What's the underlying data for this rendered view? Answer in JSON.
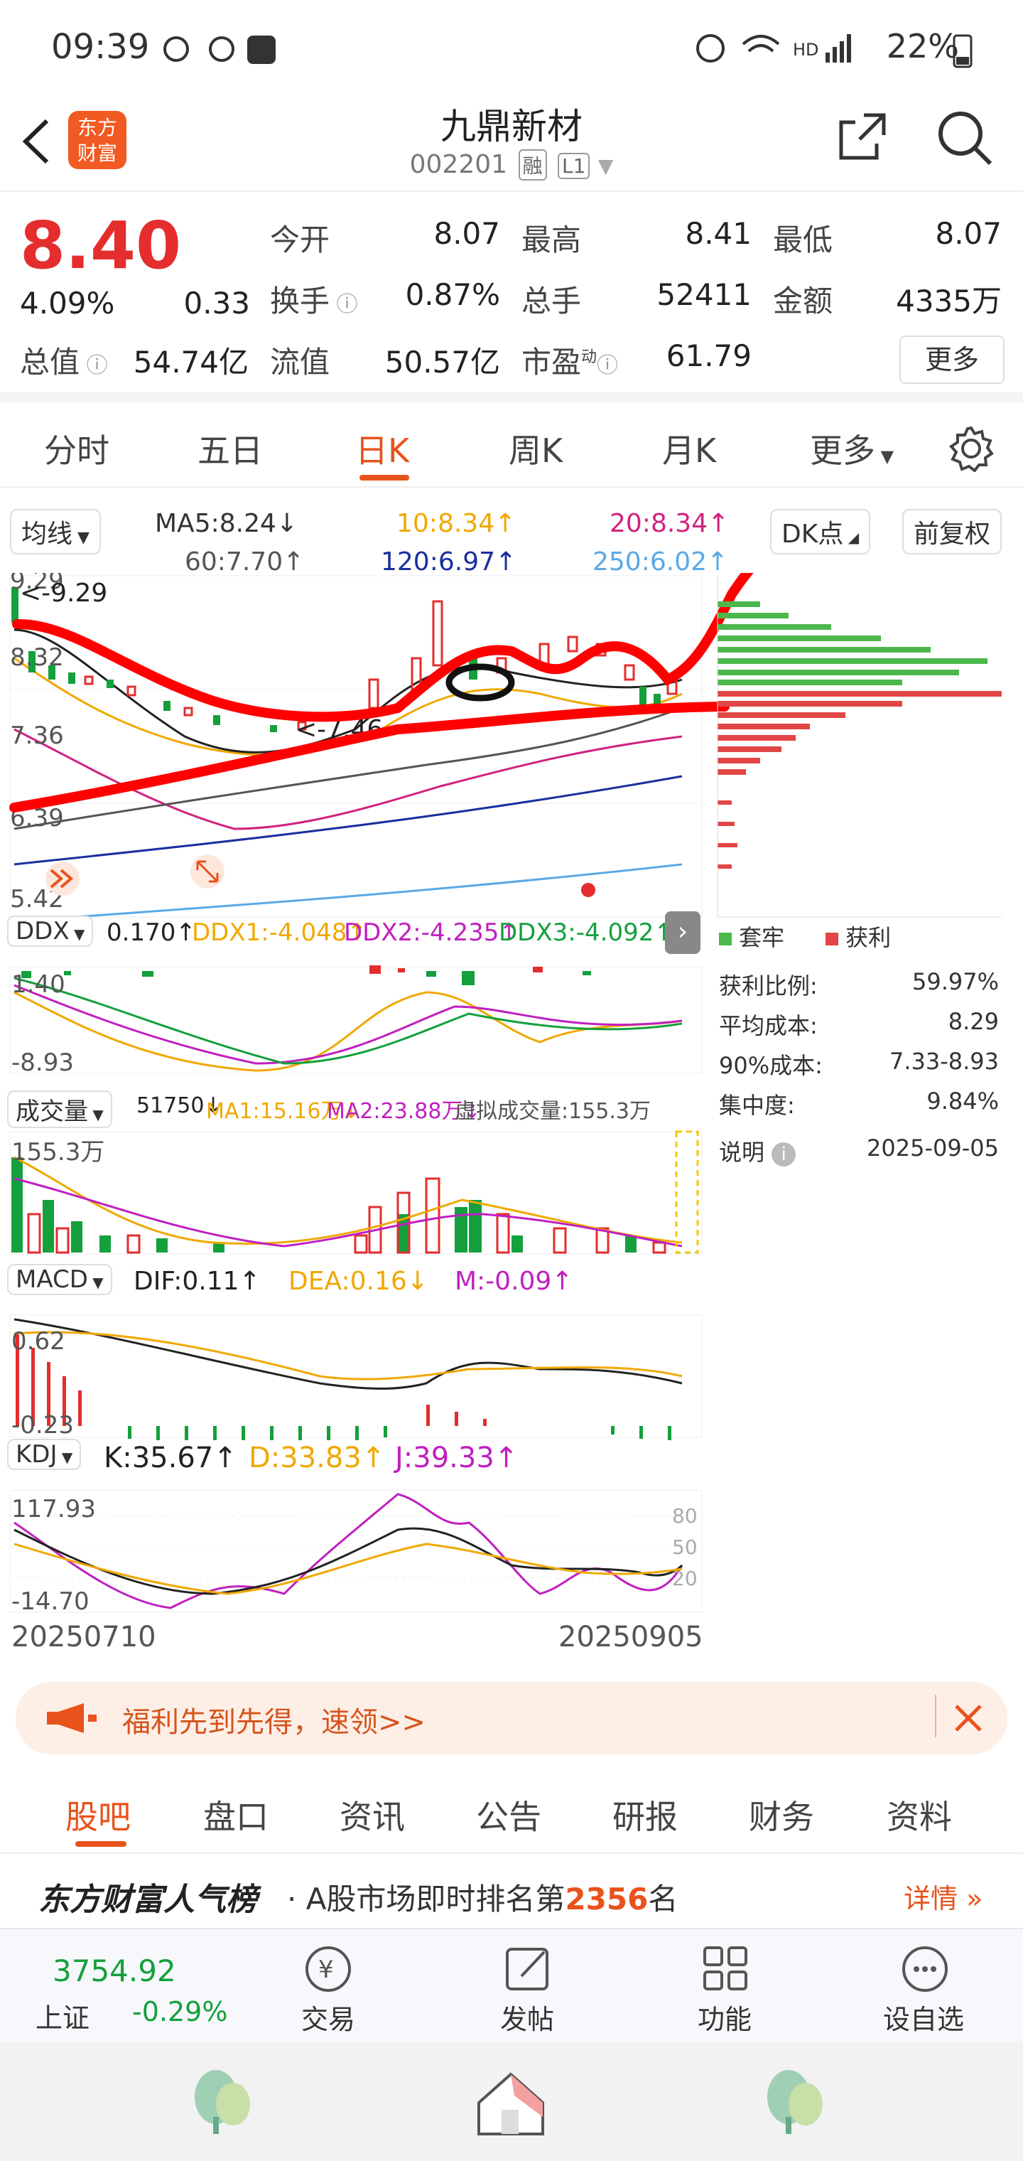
{
  "status": {
    "time": "09:39",
    "network": "HD 4G",
    "battery": "22%"
  },
  "nav": {
    "title": "九鼎新材",
    "code": "002201",
    "tag1": "融",
    "tag2": "L1",
    "logo_line1": "东方",
    "logo_line2": "财富"
  },
  "quote": {
    "price": "8.40",
    "change_pct": "4.09%",
    "change": "0.33",
    "open_label": "今开",
    "open": "8.07",
    "high_label": "最高",
    "high": "8.41",
    "low_label": "最低",
    "low": "8.07",
    "turnover_label": "换手",
    "turnover": "0.87%",
    "volume_label": "总手",
    "volume": "52411",
    "amount_label": "金额",
    "amount": "4335万",
    "mktcap_label": "总值",
    "mktcap": "54.74亿",
    "float_label": "流值",
    "float": "50.57亿",
    "pe_label": "市盈",
    "pe_sup": "动",
    "pe": "61.79",
    "more": "更多"
  },
  "tabs": [
    "分时",
    "五日",
    "日K",
    "周K",
    "月K",
    "更多"
  ],
  "chart": {
    "ma_button": "均线",
    "ma5": "MA5:8.24↓",
    "ma10": "10:8.34↑",
    "ma20": "20:8.34↑",
    "ma60": "60:7.70↑",
    "ma120": "120:6.97↑",
    "ma250": "250:6.02↑",
    "dk": "DK点",
    "fq": "前复权",
    "price_labels": [
      "9.29",
      "8.32",
      "7.36",
      "6.39",
      "5.42"
    ],
    "high_mark": "<-9.29",
    "low_mark": "<-7.46",
    "ddx": {
      "name": "DDX",
      "val": "0.170↑",
      "ddx1": "DDX1:-4.048↑",
      "ddx2": "DDX2:-4.235↑",
      "ddx3": "DDX3:-4.092↑",
      "top": "1.40",
      "bottom": "-8.93"
    },
    "vol": {
      "name": "成交量",
      "val": "51750↓",
      "ma1": "MA1:15.16万↓",
      "ma2": "MA2:23.88万↓",
      "virtual": "虚拟成交量:155.3万",
      "top": "155.3万"
    },
    "macd": {
      "name": "MACD",
      "dif": "DIF:0.11↑",
      "dea": "DEA:0.16↓",
      "m": "M:-0.09↑",
      "top": "0.62",
      "bottom": "-0.23"
    },
    "kdj": {
      "name": "KDJ",
      "k": "K:35.67↑",
      "d": "D:33.83↑",
      "j": "J:39.33↑",
      "top": "117.93",
      "bottom": "-14.70",
      "levels": [
        "80",
        "50",
        "20"
      ]
    },
    "date_start": "20250710",
    "date_end": "20250905"
  },
  "chips": {
    "legend_trap": "套牢",
    "legend_profit": "获利",
    "rows": [
      {
        "label": "获利比例:",
        "value": "59.97%"
      },
      {
        "label": "平均成本:",
        "value": "8.29"
      },
      {
        "label": "90%成本:",
        "value": "7.33-8.93"
      },
      {
        "label": "集中度:",
        "value": "9.84%"
      }
    ],
    "explain": "说明",
    "date": "2025-09-05"
  },
  "promo": {
    "text": "福利先到先得，速领>>"
  },
  "bottom_tabs": [
    "股吧",
    "盘口",
    "资讯",
    "公告",
    "研报",
    "财务",
    "资料"
  ],
  "rank": {
    "brand": "东方财富人气榜",
    "text_pre": "· A股市场即时排名第",
    "rank": "2356",
    "text_post": "名",
    "detail": "详情"
  },
  "footer": {
    "index_value": "3754.92",
    "index_name": "上证",
    "index_change": "-0.29%",
    "items": [
      "交易",
      "发帖",
      "功能",
      "设自选"
    ]
  },
  "colors": {
    "up": "#e42d2d",
    "down": "#14a03c",
    "accent": "#e8521b"
  }
}
